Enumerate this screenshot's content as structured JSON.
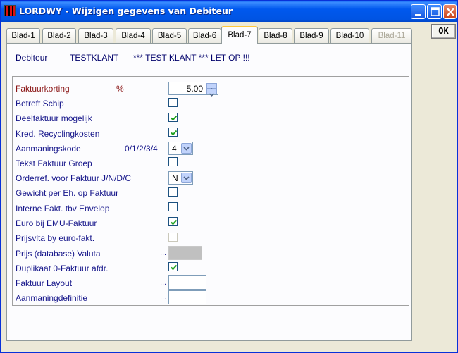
{
  "window": {
    "title": "LORDWY - Wijzigen gegevens van Debiteur"
  },
  "tabs": [
    {
      "label": "Blad-1"
    },
    {
      "label": "Blad-2"
    },
    {
      "label": "Blad-3"
    },
    {
      "label": "Blad-4"
    },
    {
      "label": "Blad-5"
    },
    {
      "label": "Blad-6"
    },
    {
      "label": "Blad-7"
    },
    {
      "label": "Blad-8"
    },
    {
      "label": "Blad-9"
    },
    {
      "label": "Blad-10"
    },
    {
      "label": "Blad-11"
    }
  ],
  "active_tab": "Blad-7",
  "disabled_tab": "Blad-11",
  "ok_label": "OK",
  "header": {
    "debiteur_label": "Debiteur",
    "debiteur_code": "TESTKLANT",
    "debiteur_name": "*** TEST KLANT  *** LET OP !!!"
  },
  "fields": {
    "faktuurkorting": {
      "label": "Faktuurkorting",
      "unit": "%",
      "value": "5.00"
    },
    "betreft_schip": {
      "label": "Betreft Schip",
      "checked": false
    },
    "deelfaktuur": {
      "label": "Deelfaktuur mogelijk",
      "checked": true
    },
    "recyclingkosten": {
      "label": "Kred. Recyclingkosten",
      "checked": true
    },
    "aanmaningskode": {
      "label": "Aanmaningskode",
      "hint": "0/1/2/3/4",
      "value": "4"
    },
    "tekst_faktuur_groep": {
      "label": "Tekst Faktuur Groep",
      "checked": false
    },
    "orderref": {
      "label": "Orderref. voor Faktuur J/N/D/C",
      "value": "N"
    },
    "gewicht": {
      "label": "Gewicht per Eh. op Faktuur",
      "checked": false
    },
    "interne_fakt": {
      "label": "Interne Fakt. tbv Envelop",
      "checked": false
    },
    "euro_emu": {
      "label": "Euro bij EMU-Faktuur",
      "checked": true
    },
    "prijsvlta": {
      "label": "Prijsvlta by euro-fakt.",
      "checked": false,
      "disabled": true
    },
    "prijs_valuta": {
      "label": "Prijs (database) Valuta",
      "dots": "...",
      "value": ""
    },
    "duplikaat": {
      "label": "Duplikaat 0-Faktuur afdr.",
      "checked": true
    },
    "faktuur_layout": {
      "label": "Faktuur Layout",
      "dots": "...",
      "value": ""
    },
    "aanmaningdefinitie": {
      "label": "Aanmaningdefinitie",
      "dots": "...",
      "value": ""
    }
  },
  "colors": {
    "titlebar": "#0054e3",
    "label": "#15158a",
    "label_red": "#8a1515",
    "check": "#21a121",
    "tab_highlight": "#ffc83c"
  }
}
